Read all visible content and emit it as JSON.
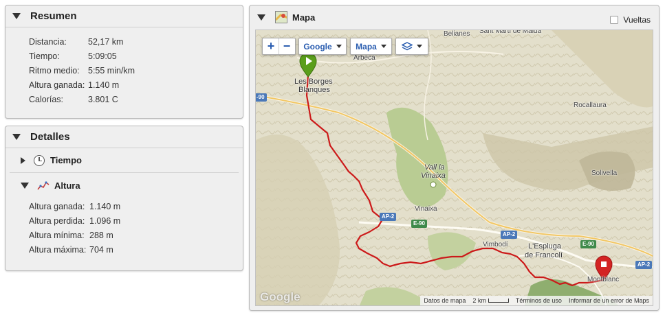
{
  "resumen": {
    "title": "Resumen",
    "rows": [
      {
        "label": "Distancia:",
        "value": "52,17 km"
      },
      {
        "label": "Tiempo:",
        "value": "5:09:05"
      },
      {
        "label": "Ritmo medio:",
        "value": "5:55 min/km"
      },
      {
        "label": "Altura ganada:",
        "value": "1.140 m"
      },
      {
        "label": "Calorías:",
        "value": "3.801 C"
      }
    ]
  },
  "detalles": {
    "title": "Detalles",
    "tiempo_label": "Tiempo",
    "altura_label": "Altura",
    "rows": [
      {
        "label": "Altura ganada:",
        "value": "1.140 m"
      },
      {
        "label": "Altura perdida:",
        "value": "1.096 m"
      },
      {
        "label": "Altura mínima:",
        "value": "288 m"
      },
      {
        "label": "Altura máxima:",
        "value": "704 m"
      }
    ]
  },
  "mapa": {
    "title": "Mapa",
    "vueltas_label": "Vueltas",
    "provider_label": "Google",
    "maptype_label": "Mapa",
    "places": {
      "bellianes": "Belianes",
      "sant_marti": "Sant Martí de Maldà",
      "arbeca": "Arbeca",
      "borges_1": "Les Borges",
      "borges_2": "Blanques",
      "rocallaura": "Rocallaura",
      "vall_1": "Vall la",
      "vall_2": "Vinaixa",
      "vinaixa": "Vinaixa",
      "solivella": "Solivella",
      "vimbodi": "Vimbodí",
      "espluga_1": "L'Espluga",
      "espluga_2": "de Francolí",
      "montblanc": "Montblanc"
    },
    "roads": {
      "a90": "-90",
      "ap2_a": "AP-2",
      "e90_a": "E-90",
      "ap2_b": "AP-2",
      "e90_b": "E-90",
      "ap2_c": "AP-2"
    },
    "attribution": {
      "datos": "Datos de mapa",
      "scale": "2 km",
      "terminos": "Términos de uso",
      "error": "Informar de un error de Maps"
    },
    "watermark": "Google",
    "colors": {
      "route": "#cc1a1a",
      "start_marker": "#5a9e1b",
      "end_marker": "#d32424"
    }
  }
}
